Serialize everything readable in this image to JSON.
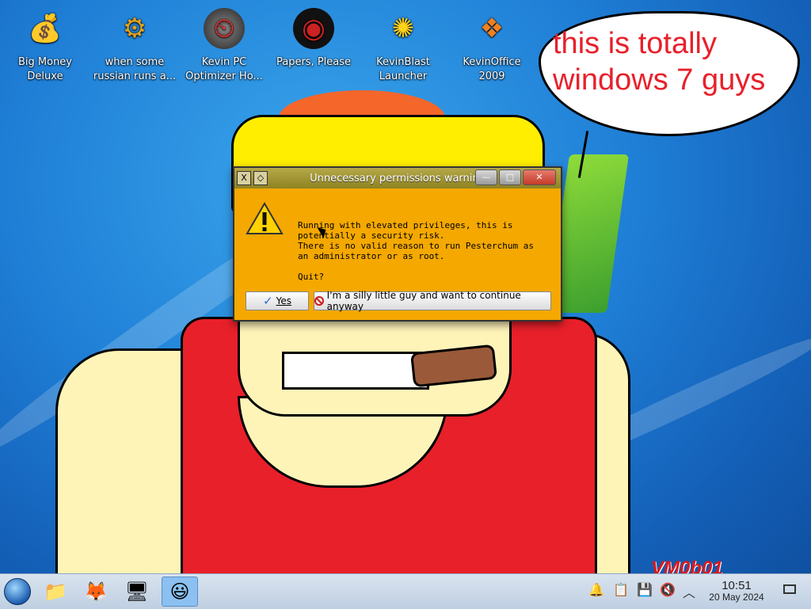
{
  "desktop": {
    "icons": [
      {
        "label_line1": "Big Money",
        "label_line2": "Deluxe",
        "icon": "money-bag-icon",
        "glyph": "💰"
      },
      {
        "label_line1": "when some",
        "label_line2": "russian runs a...",
        "icon": "gear-icon",
        "glyph": "⚙"
      },
      {
        "label_line1": "Kevin PC",
        "label_line2": "Optimizer Ho...",
        "icon": "speedometer-icon",
        "glyph": "⏲"
      },
      {
        "label_line1": "Papers, Please",
        "label_line2": "",
        "icon": "stamp-icon",
        "glyph": "◉"
      },
      {
        "label_line1": "KevinBlast",
        "label_line2": "Launcher",
        "icon": "globe-burst-icon",
        "glyph": "✺"
      },
      {
        "label_line1": "KevinOffice",
        "label_line2": "2009",
        "icon": "office-logo-icon",
        "glyph": "❖"
      }
    ],
    "speech_bubble": {
      "line1": "this is totally",
      "line2": "windows 7 guys"
    },
    "watermark": "VM0b01"
  },
  "dialog": {
    "title": "Unnecessary permissions warning",
    "message_lines": [
      "Running with elevated privileges, this is",
      "potentially a security risk.",
      "There is no valid reason to run Pesterchum as",
      "an administrator or as root.",
      "",
      "Quit?"
    ],
    "buttons": {
      "yes": "Yes",
      "continue": "I'm a silly little guy and want to continue anyway"
    },
    "titlebar_buttons": {
      "close_left": "X",
      "menu": "◇",
      "minimize": "—",
      "maximize": "□",
      "close": "✕"
    }
  },
  "taskbar": {
    "items": [
      {
        "name": "start-button",
        "icon": "windows-orb-icon"
      },
      {
        "name": "file-manager",
        "icon": "folder-icon",
        "glyph": "📁"
      },
      {
        "name": "firefox",
        "icon": "firefox-icon",
        "glyph": "🦊"
      },
      {
        "name": "control-panel",
        "icon": "settings-monitor-icon",
        "glyph": "🖥"
      },
      {
        "name": "pesterchum",
        "icon": "pesterchum-smiley-icon",
        "glyph": "😃",
        "active": true
      }
    ],
    "tray": {
      "notifications_glyph": "🔔",
      "clipboard_glyph": "📋",
      "storage_glyph": "💾",
      "volume_glyph": "🔇",
      "expand_glyph": "︿"
    },
    "clock": {
      "time": "10:51",
      "date": "20 May 2024"
    }
  },
  "colors": {
    "dialog_bg": "#f4a800",
    "bubble_text": "#e8202a",
    "taskbar": "#d9e3ef"
  }
}
